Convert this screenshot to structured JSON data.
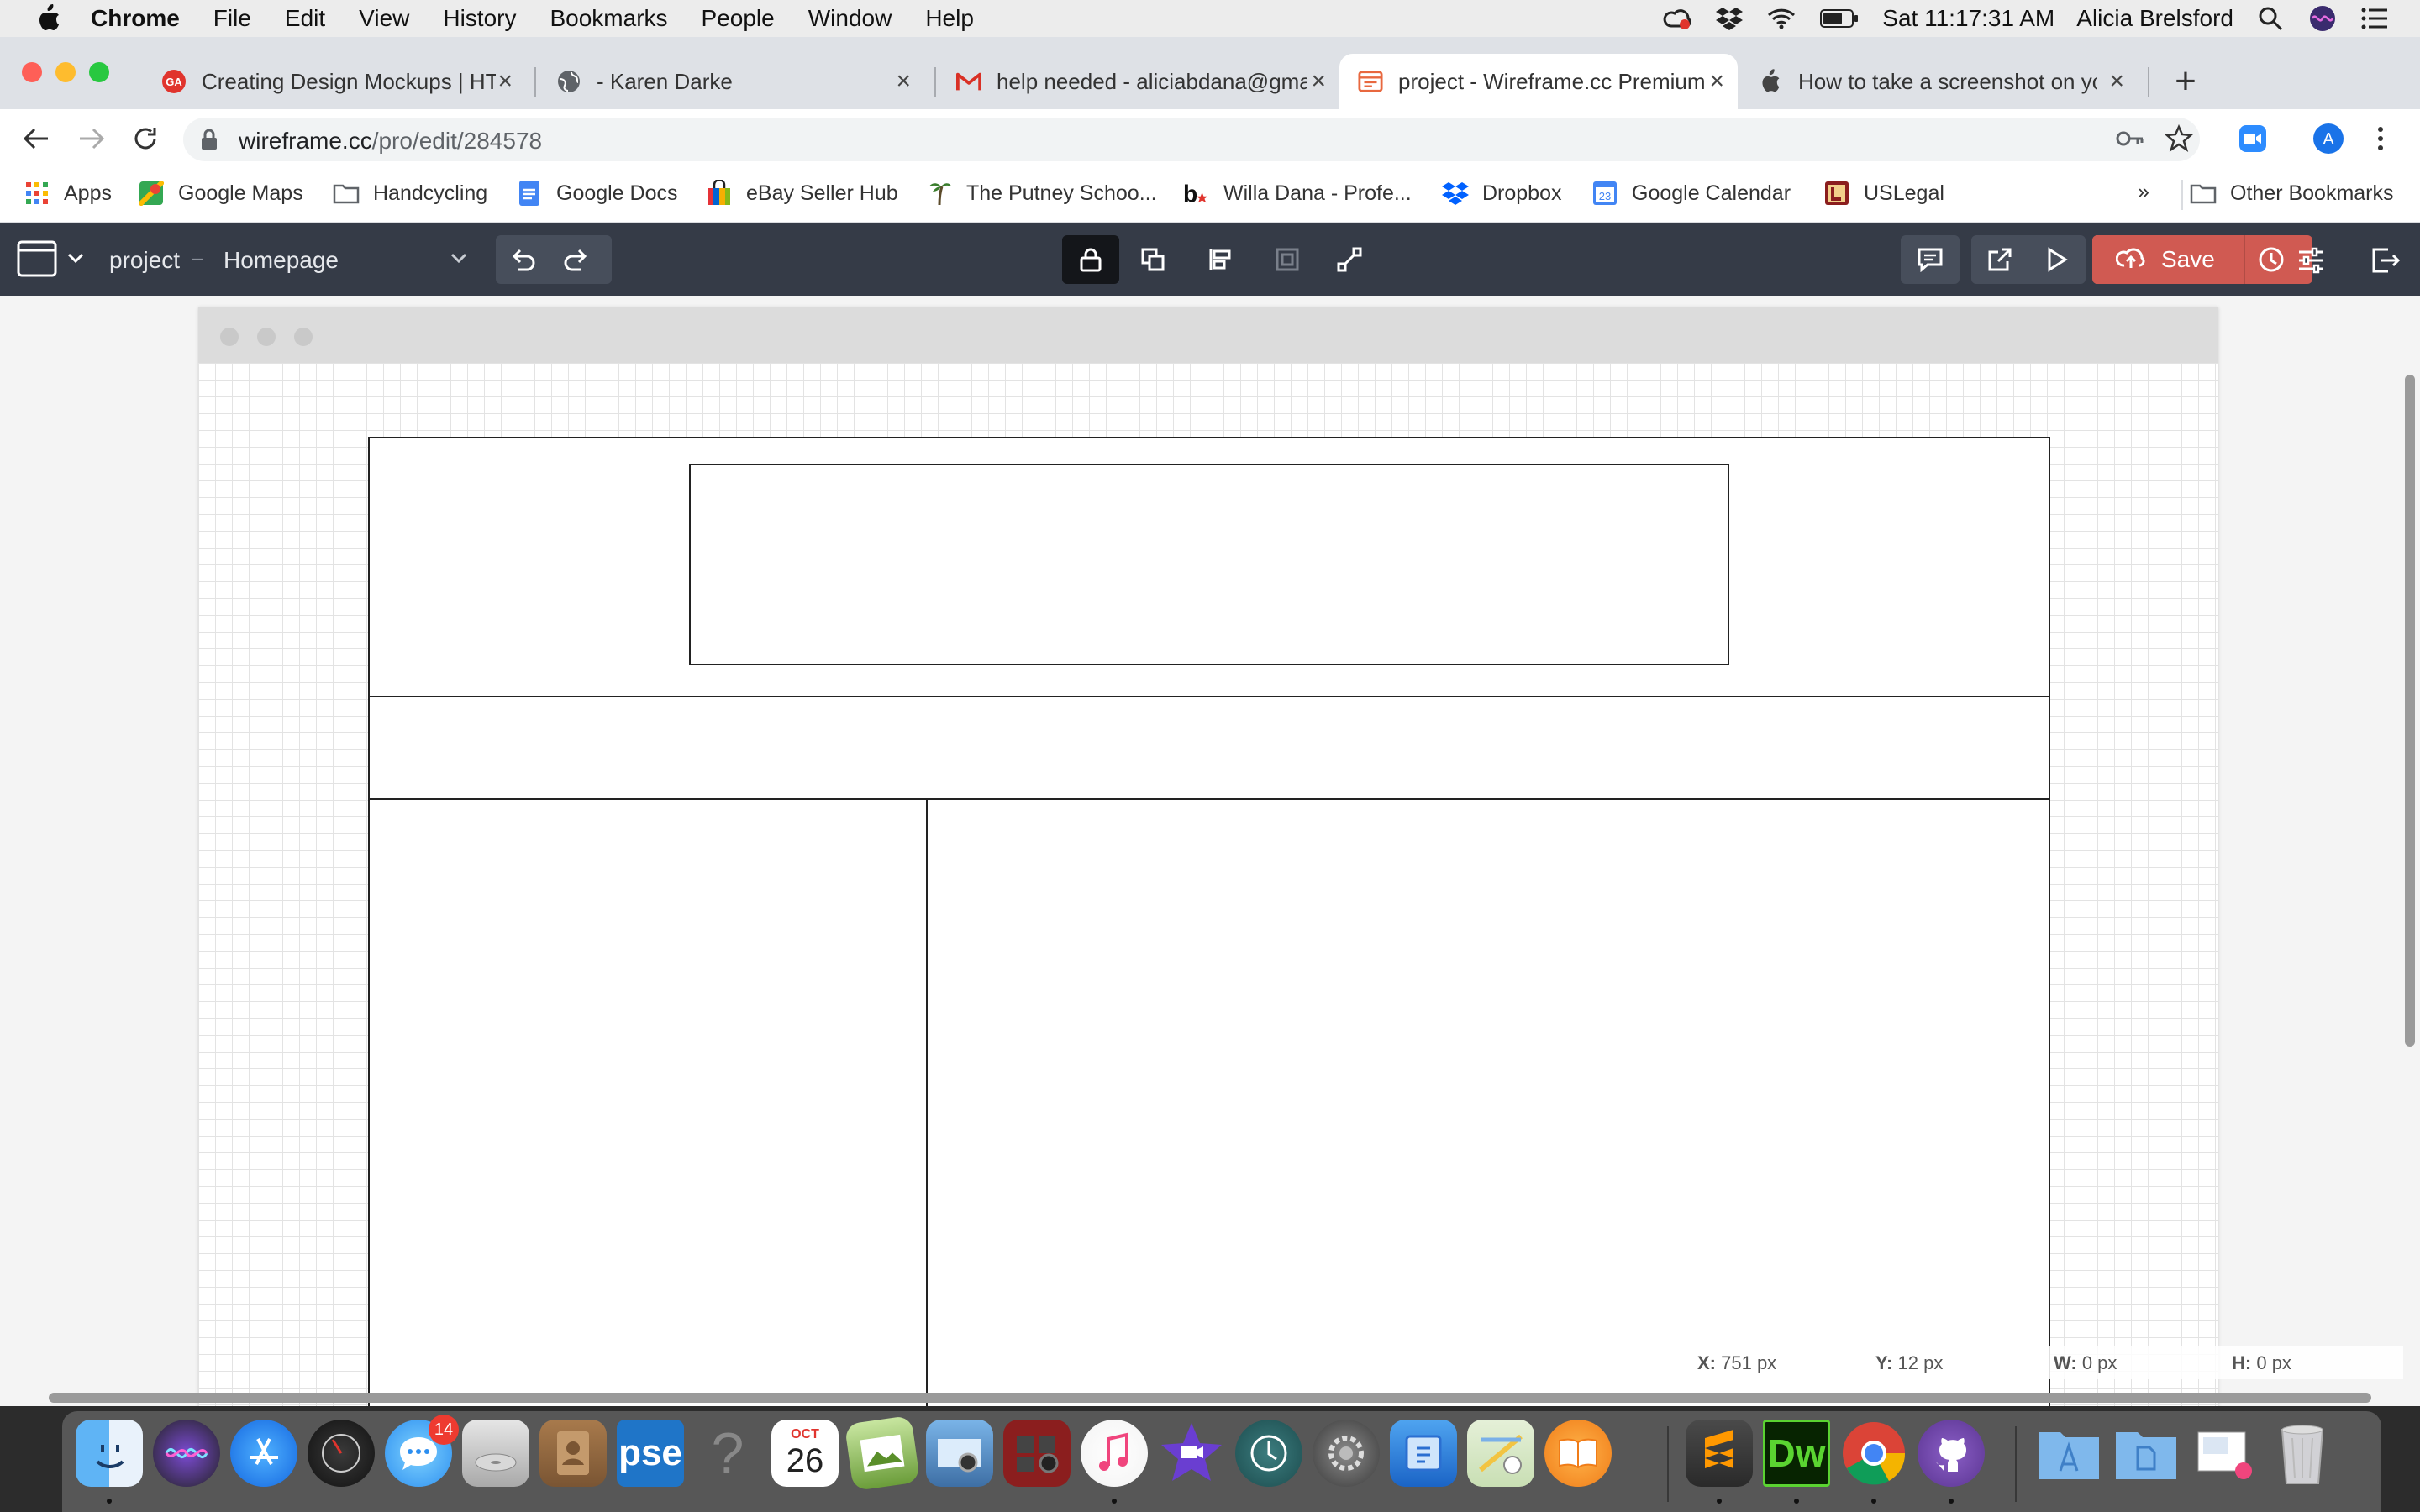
{
  "menubar": {
    "app_name": "Chrome",
    "items": [
      "File",
      "Edit",
      "View",
      "History",
      "Bookmarks",
      "People",
      "Window",
      "Help"
    ],
    "clock": "Sat 11:17:31 AM",
    "user": "Alicia Brelsford"
  },
  "tabs": [
    {
      "title": "Creating Design Mockups | HTML",
      "icon": "ga-icon",
      "active": false
    },
    {
      "title": "- Karen Darke",
      "icon": "globe-icon",
      "active": false
    },
    {
      "title": "help needed - aliciabdana@gmail",
      "icon": "gmail-icon",
      "active": false
    },
    {
      "title": "project - Wireframe.cc Premium",
      "icon": "wireframe-icon",
      "active": true
    },
    {
      "title": "How to take a screenshot on your",
      "icon": "apple-icon",
      "active": false
    }
  ],
  "toolbar": {
    "url_domain": "wireframe.cc",
    "url_path": "/pro/edit/284578",
    "profile_initial": "A"
  },
  "bookmarks": {
    "items": [
      "Apps",
      "Google Maps",
      "Handcycling",
      "Google Docs",
      "eBay Seller Hub",
      "The Putney Schoo...",
      "Willa Dana - Profe...",
      "Dropbox",
      "Google Calendar",
      "USLegal"
    ],
    "overflow": "»",
    "other": "Other Bookmarks"
  },
  "appbar": {
    "project": "project",
    "separator": "–",
    "page": "Homepage",
    "save_label": "Save"
  },
  "status": {
    "x_label": "X:",
    "x_value": "751 px",
    "y_label": "Y:",
    "y_value": "12 px",
    "w_label": "W:",
    "w_value": "0 px",
    "h_label": "H:",
    "h_value": "0 px"
  },
  "dock": {
    "messages_badge": "14",
    "calendar_month": "OCT",
    "calendar_day": "26",
    "pse_label": "pse",
    "dw_label": "Dw"
  },
  "colors": {
    "appbar_bg": "#353b47",
    "save_bg": "#d05a52",
    "tab_strip": "#dee1e6"
  }
}
